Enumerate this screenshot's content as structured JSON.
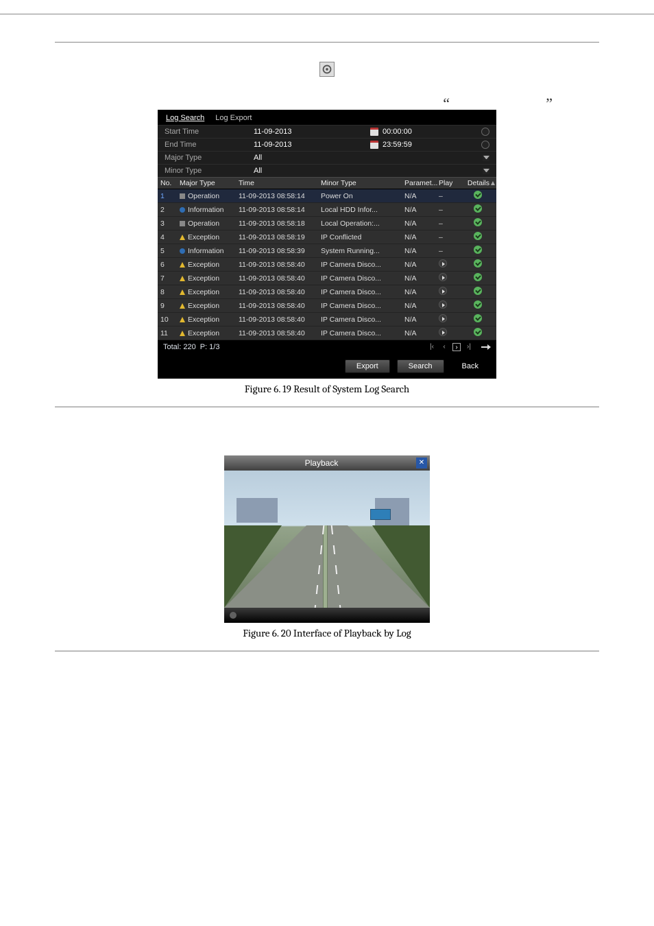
{
  "logpanel": {
    "tabs": {
      "search": "Log Search",
      "export": "Log Export"
    },
    "fields": {
      "start_label": "Start Time",
      "start_date": "11-09-2013",
      "start_time": "00:00:00",
      "end_label": "End Time",
      "end_date": "11-09-2013",
      "end_time": "23:59:59",
      "major_label": "Major Type",
      "major_value": "All",
      "minor_label": "Minor Type",
      "minor_value": "All"
    },
    "headers": {
      "no": "No.",
      "major": "Major Type",
      "time": "Time",
      "minor": "Minor Type",
      "param": "Paramet...",
      "play": "Play",
      "details": "Details"
    },
    "rows": [
      {
        "no": "1",
        "major": "Operation",
        "time": "11-09-2013 08:58:14",
        "minor": "Power On",
        "param": "N/A",
        "play": "-",
        "icon": "op"
      },
      {
        "no": "2",
        "major": "Information",
        "time": "11-09-2013 08:58:14",
        "minor": "Local HDD Infor...",
        "param": "N/A",
        "play": "-",
        "icon": "info"
      },
      {
        "no": "3",
        "major": "Operation",
        "time": "11-09-2013 08:58:18",
        "minor": "Local Operation:...",
        "param": "N/A",
        "play": "-",
        "icon": "op"
      },
      {
        "no": "4",
        "major": "Exception",
        "time": "11-09-2013 08:58:19",
        "minor": "IP Conflicted",
        "param": "N/A",
        "play": "-",
        "icon": "exc"
      },
      {
        "no": "5",
        "major": "Information",
        "time": "11-09-2013 08:58:39",
        "minor": "System Running...",
        "param": "N/A",
        "play": "-",
        "icon": "info"
      },
      {
        "no": "6",
        "major": "Exception",
        "time": "11-09-2013 08:58:40",
        "minor": "IP Camera Disco...",
        "param": "N/A",
        "play": "play",
        "icon": "exc"
      },
      {
        "no": "7",
        "major": "Exception",
        "time": "11-09-2013 08:58:40",
        "minor": "IP Camera Disco...",
        "param": "N/A",
        "play": "play",
        "icon": "exc"
      },
      {
        "no": "8",
        "major": "Exception",
        "time": "11-09-2013 08:58:40",
        "minor": "IP Camera Disco...",
        "param": "N/A",
        "play": "play",
        "icon": "exc"
      },
      {
        "no": "9",
        "major": "Exception",
        "time": "11-09-2013 08:58:40",
        "minor": "IP Camera Disco...",
        "param": "N/A",
        "play": "play",
        "icon": "exc"
      },
      {
        "no": "10",
        "major": "Exception",
        "time": "11-09-2013 08:58:40",
        "minor": "IP Camera Disco...",
        "param": "N/A",
        "play": "play",
        "icon": "exc"
      },
      {
        "no": "11",
        "major": "Exception",
        "time": "11-09-2013 08:58:40",
        "minor": "IP Camera Disco...",
        "param": "N/A",
        "play": "play",
        "icon": "exc"
      }
    ],
    "footer": {
      "total": "Total: 220",
      "page": "P: 1/3"
    },
    "buttons": {
      "export": "Export",
      "search": "Search",
      "back": "Back"
    }
  },
  "caption1": "Figure 6. 19 Result of System Log Search",
  "playback": {
    "title": "Playback"
  },
  "caption2": "Figure 6. 20 Interface of Playback by Log"
}
